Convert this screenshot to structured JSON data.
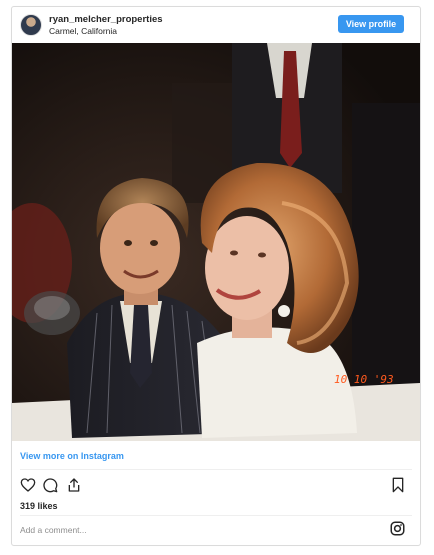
{
  "profile": {
    "username": "ryan_melcher_properties",
    "location": "Carmel, California",
    "view_profile_label": "View profile"
  },
  "photo": {
    "date_stamp": "10 10 '93"
  },
  "post": {
    "view_more_label": "View more on Instagram",
    "likes_text": "319 likes",
    "comment_placeholder": "Add a comment..."
  },
  "icons": {
    "like": "heart-icon",
    "comment": "comment-icon",
    "share": "share-icon",
    "save": "bookmark-icon",
    "brand": "instagram-icon",
    "avatar": "avatar"
  },
  "colors": {
    "accent": "#3897f0",
    "border": "#dbdbdb",
    "text": "#262626",
    "muted": "#8e8e8e",
    "date_stamp": "#ff5a1f"
  }
}
